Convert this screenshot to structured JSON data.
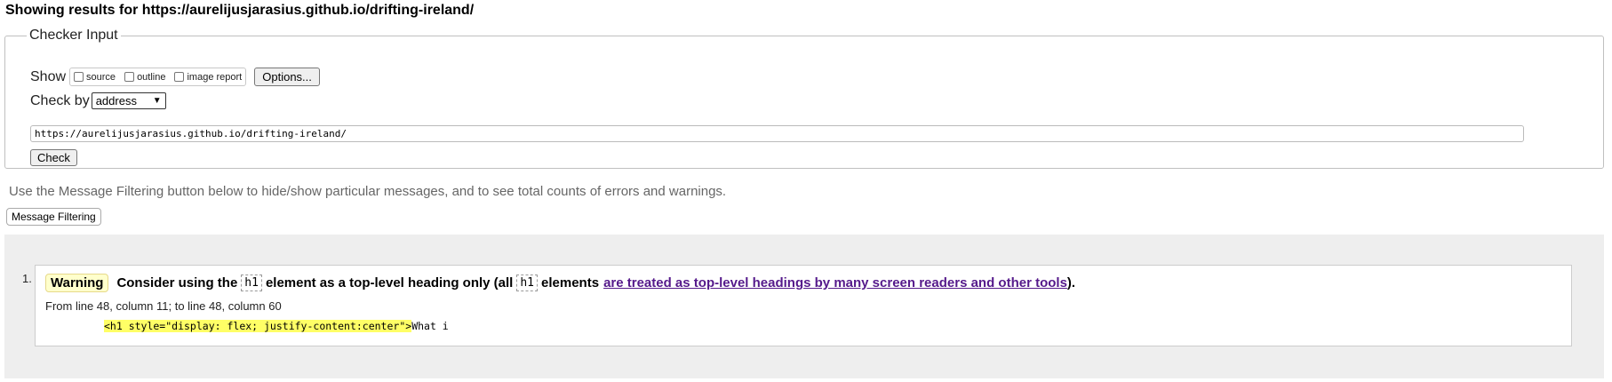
{
  "header": {
    "results_title": "Showing results for https://aurelijusjarasius.github.io/drifting-ireland/"
  },
  "checker": {
    "legend": "Checker Input",
    "show_label": "Show",
    "show_options": [
      {
        "label": "source",
        "checked": false
      },
      {
        "label": "outline",
        "checked": false
      },
      {
        "label": "image report",
        "checked": false
      }
    ],
    "options_button": "Options...",
    "check_by_label": "Check by",
    "check_by_value": "address",
    "url_value": "https://aurelijusjarasius.github.io/drifting-ireland/",
    "check_button": "Check"
  },
  "filter": {
    "hint": "Use the Message Filtering button below to hide/show particular messages, and to see total counts of errors and warnings.",
    "button": "Message Filtering"
  },
  "messages": [
    {
      "number": "1.",
      "type": "Warning",
      "text_part1": "Consider using the",
      "code1": "h1",
      "text_part2": "element as a top-level heading only (all",
      "code2": "h1",
      "text_part3": "elements",
      "link": "are treated as top-level headings by many screen readers and other tools",
      "text_part4": ").",
      "location": "From line 48, column 11; to line 48, column 60",
      "extract_highlight": "<h1 style=\"display: flex; justify-content:center\">",
      "extract_rest": "What i"
    }
  ],
  "colors": {
    "warning_badge": "#ffffcc",
    "highlight": "#ffff66",
    "link": "#551a8b",
    "panel_bg": "#eeeeee"
  }
}
